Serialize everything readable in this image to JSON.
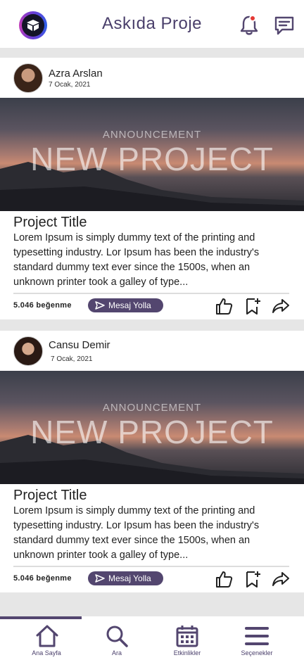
{
  "header": {
    "title": "Askıda Proje",
    "icons": [
      "logo-icon",
      "bell-icon",
      "message-icon"
    ],
    "accent_color": "#53466f",
    "notification_color": "#e53935"
  },
  "posts": [
    {
      "author": "Azra Arslan",
      "date": "7 Ocak, 2021",
      "banner": {
        "subtitle": "ANNOUNCEMENT",
        "title": "NEW PROJECT"
      },
      "title": "Project Title",
      "body": "Lorem Ipsum is simply dummy text of the printing and typesetting industry. Lor Ipsum has been the industry's standard dummy text ever since the 1500s, when an unknown printer took a galley of type...",
      "likes": "5.046 beğenme",
      "message_button": "Mesaj Yolla"
    },
    {
      "author": "Cansu Demir",
      "date": "7 Ocak, 2021",
      "banner": {
        "subtitle": "ANNOUNCEMENT",
        "title": "NEW PROJECT"
      },
      "title": "Project Title",
      "body": "Lorem Ipsum is simply dummy text of the printing and typesetting industry. Lor Ipsum has been the industry's standard dummy text ever since the 1500s, when an unknown printer took a galley of type...",
      "likes": "5.046 beğenme",
      "message_button": "Mesaj Yolla"
    }
  ],
  "nav": {
    "active": "Ana Sayfa",
    "items": [
      {
        "label": "Ana Sayfa",
        "icon": "home-icon"
      },
      {
        "label": "Ara",
        "icon": "search-icon"
      },
      {
        "label": "Etkinlikler",
        "icon": "calendar-icon"
      },
      {
        "label": "Seçenekler",
        "icon": "menu-icon"
      }
    ]
  }
}
